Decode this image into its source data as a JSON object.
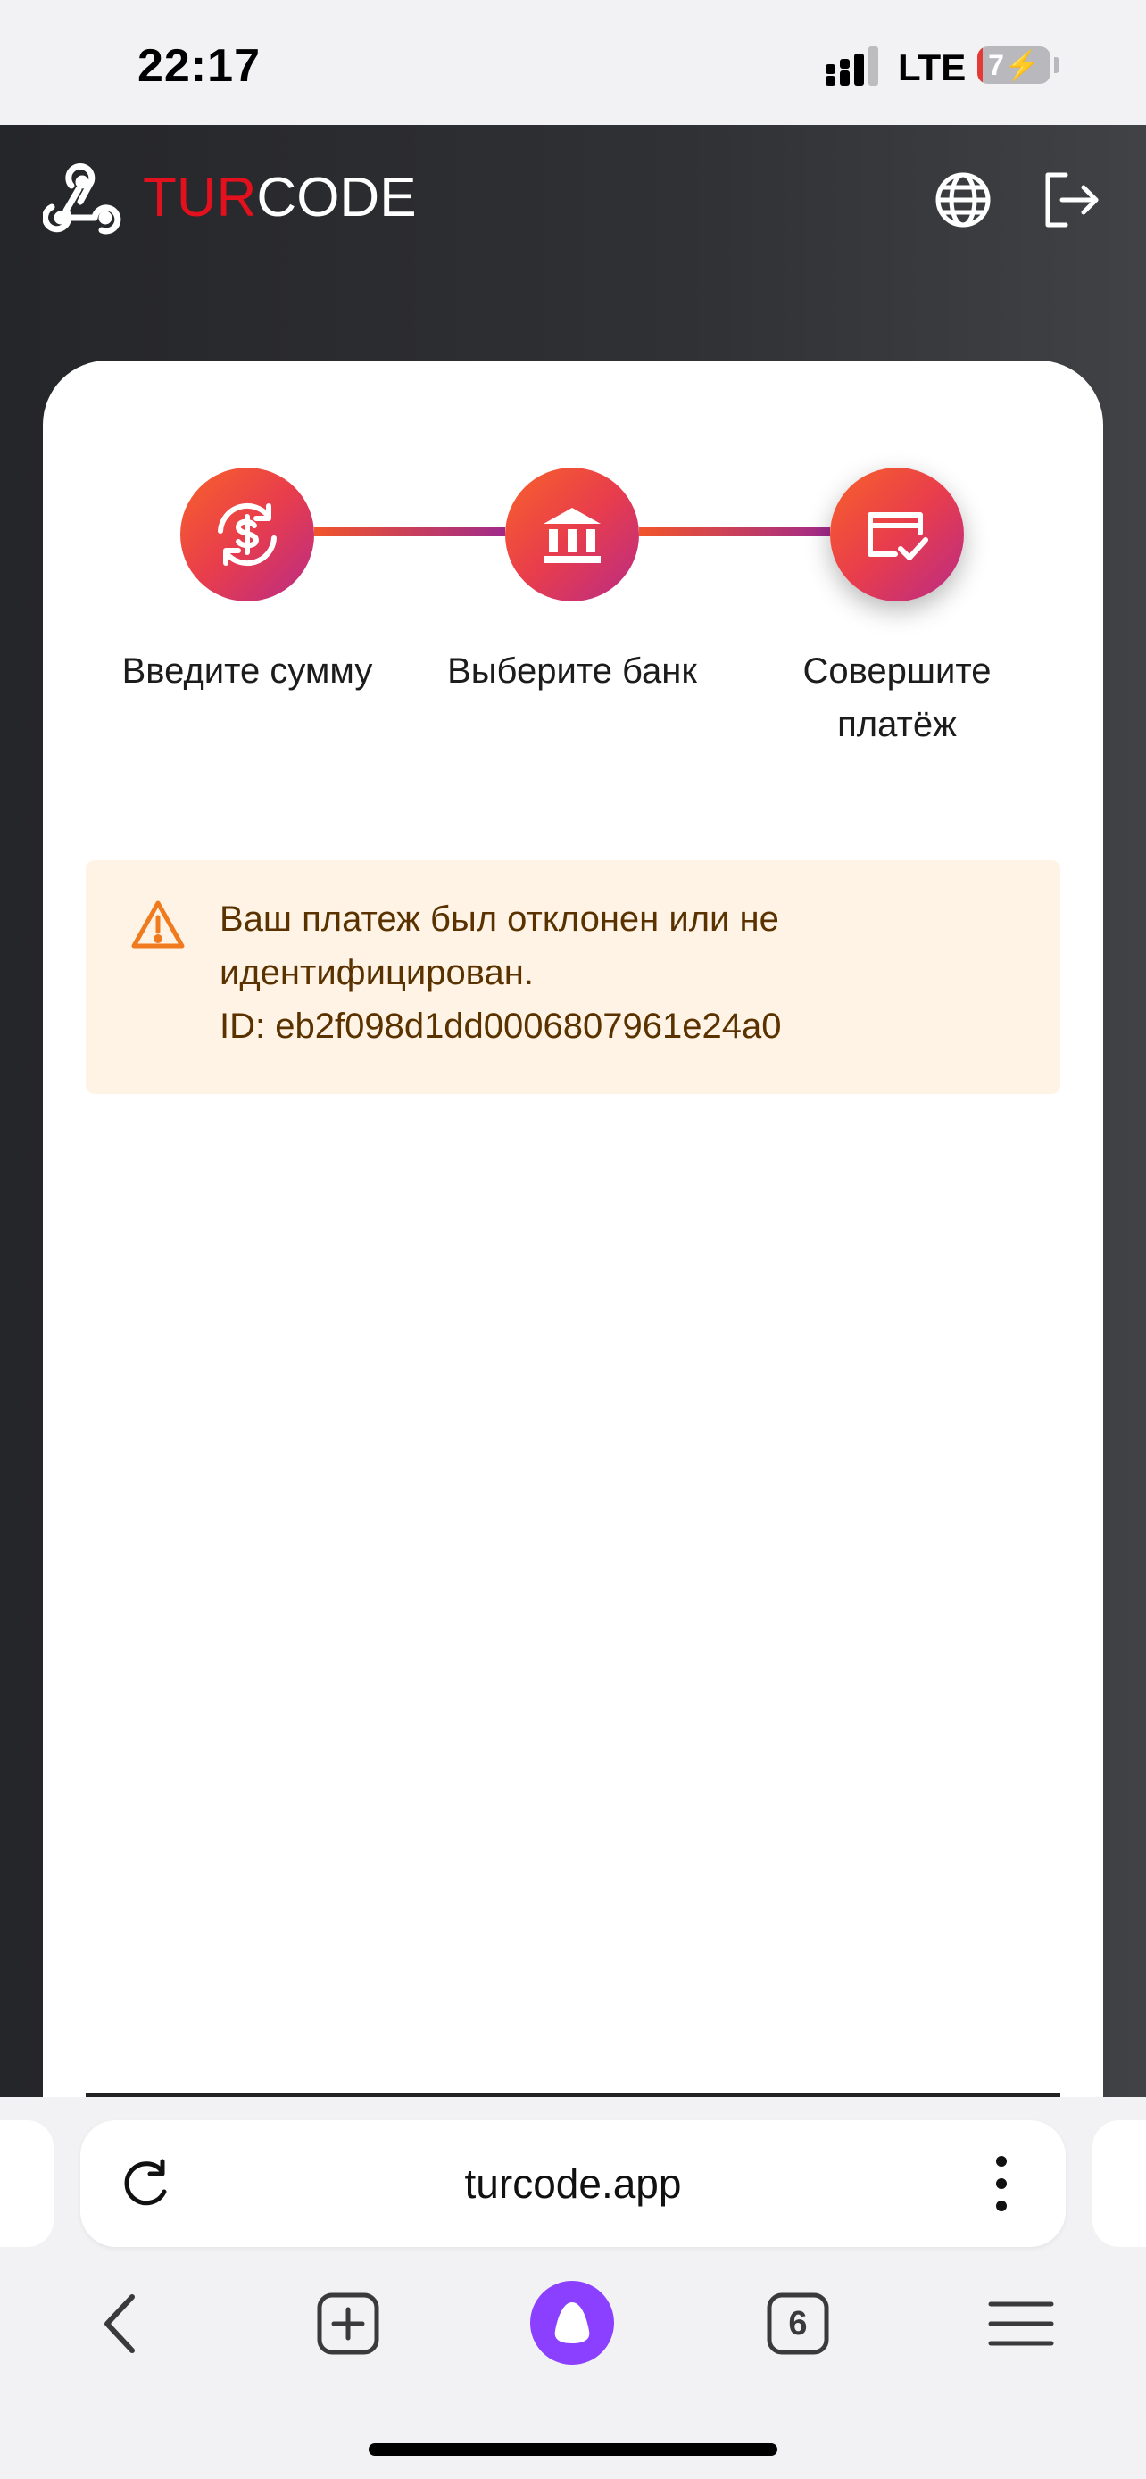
{
  "status_bar": {
    "time": "22:17",
    "network": "LTE",
    "battery": "7",
    "battery_level": 0.07
  },
  "header": {
    "logo_part1": "TUR",
    "logo_part2": "CODE",
    "accent_color": "#e3101e",
    "icons": [
      "webhook-logo-icon",
      "globe-icon",
      "logout-icon"
    ]
  },
  "steps": [
    {
      "label_line1": "Введите сумму",
      "label_line2": "",
      "icon": "currency-exchange-icon"
    },
    {
      "label_line1": "Выберите банк",
      "label_line2": "",
      "icon": "bank-icon"
    },
    {
      "label_line1": "Совершите",
      "label_line2": "платёж",
      "icon": "card-check-icon",
      "active": true
    }
  ],
  "alert": {
    "line1": "Ваш платеж был отклонен или не",
    "line2": "идентифицирован.",
    "line3": "ID: eb2f098d1dd0006807961e24a0",
    "icon": "warning-icon",
    "background_color": "#fff3e5",
    "text_color": "#5a3200"
  },
  "browser": {
    "url": "turcode.app",
    "tabs_count": "6",
    "icons": [
      "reload-icon",
      "more-vertical-icon",
      "back-icon",
      "new-tab-icon",
      "alice-assistant-icon",
      "tabs-icon",
      "menu-icon"
    ]
  }
}
